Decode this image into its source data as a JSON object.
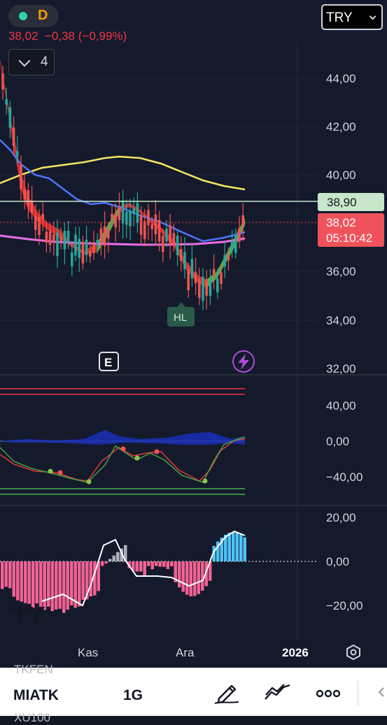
{
  "header": {
    "timeframe": "D",
    "price_line": "38,02  −0,38 (−0,99%)",
    "indicator_count": "4",
    "currency": "TRY",
    "colors": {
      "negative": "#f23645",
      "positive": "#26a69a",
      "status_dot": "#2bd6a0",
      "timeframe_badge": "#ff9800"
    }
  },
  "price_pane": {
    "axis_labels": [
      "44,00",
      "42,00",
      "40,00",
      "36,00",
      "34,00",
      "32,00"
    ],
    "horizontal_line_label": "38,90",
    "last_price_label": "38,02",
    "countdown_label": "05:10:42",
    "pattern_label": "HL",
    "earnings_marker": "E",
    "event_icon": "lightning-icon"
  },
  "oscillator_pane": {
    "axis_labels": [
      "40,00",
      "0,00",
      "−40,00"
    ]
  },
  "histogram_pane": {
    "axis_labels": [
      "20,00",
      "0,00",
      "−20,00"
    ]
  },
  "time_axis": {
    "labels": [
      "Kas",
      "Ara",
      "2026"
    ]
  },
  "bottom_bar": {
    "symbol": "MIATK",
    "interval": "1G",
    "ghost_top": "TKFEN",
    "ghost_bottom": "XU100",
    "icons": [
      "pencil-icon",
      "drawing-tools-icon",
      "more-icon",
      "back-arrow-icon"
    ]
  }
}
